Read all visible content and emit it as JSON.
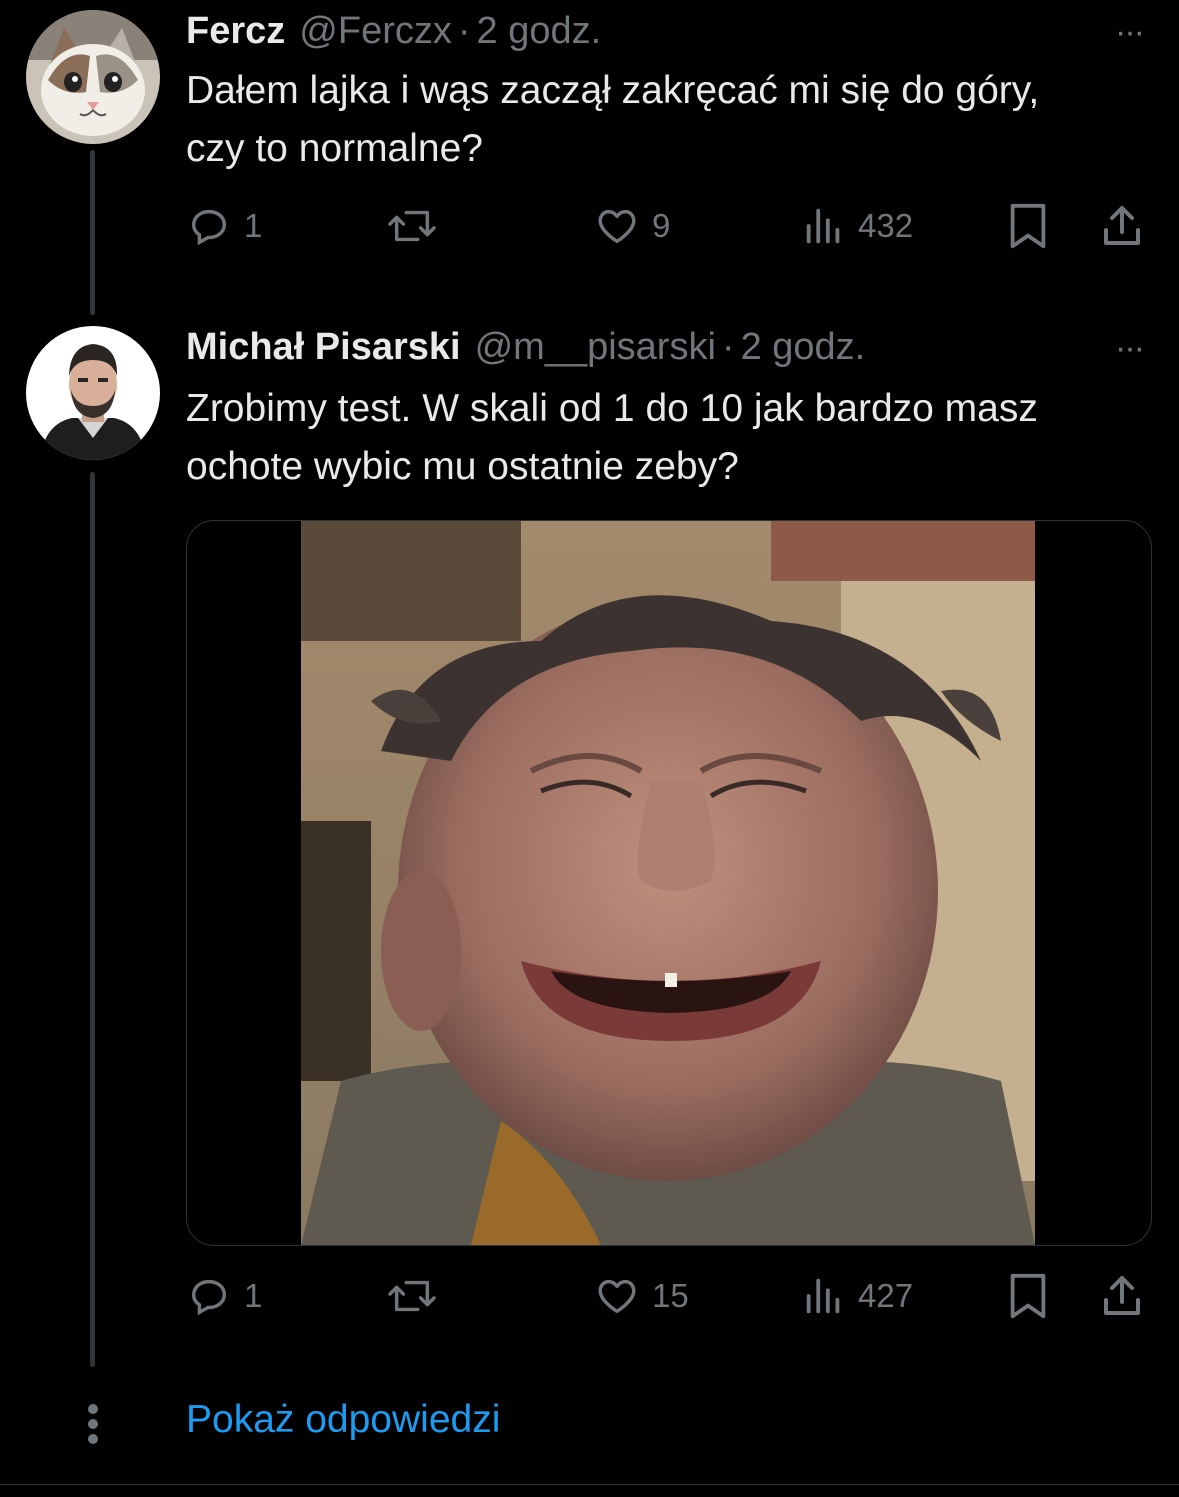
{
  "tweets": [
    {
      "display_name": "Fercz",
      "handle": "@Ferczx",
      "separator": "·",
      "time": "2 godz.",
      "more": "···",
      "text": "Dałem lajka i wąs zaczął zakręcać mi się do góry, czy to normalne?",
      "avatar_icon": "cat-avatar",
      "replies": "1",
      "reposts": "",
      "likes": "9",
      "views": "432"
    },
    {
      "display_name": "Michał Pisarski",
      "handle": "@m__pisarski",
      "separator": "·",
      "time": "2 godz.",
      "more": "···",
      "text": "Zrobimy test. W skali od 1 do 10 jak bardzo masz ochote wybic mu ostatnie zeby?",
      "avatar_icon": "man-avatar",
      "replies": "1",
      "reposts": "",
      "likes": "15",
      "views": "427"
    }
  ],
  "show_replies": "Pokaż odpowiedzi",
  "icons": [
    "reply-icon",
    "repost-icon",
    "like-icon",
    "views-icon",
    "bookmark-icon",
    "share-icon"
  ],
  "colors": {
    "background": "#000000",
    "text": "#e7e9ea",
    "muted": "#71767b",
    "link": "#1d9bf0",
    "border": "#2f3336"
  }
}
